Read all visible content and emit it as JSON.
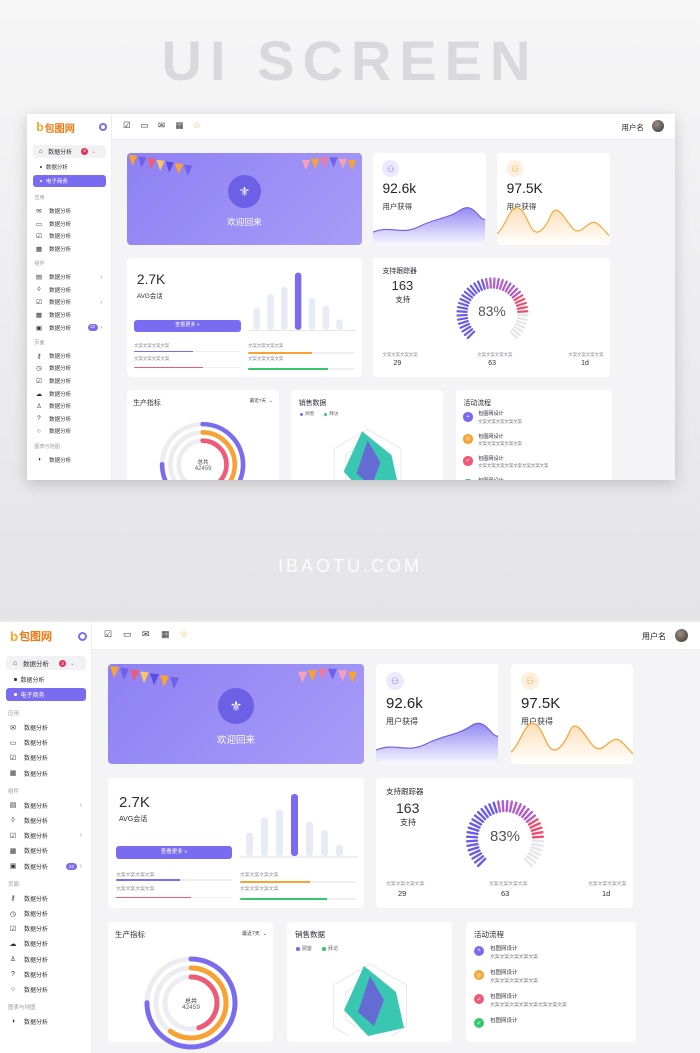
{
  "banner": {
    "title": "UI SCREEN",
    "watermark": "IBAOTU.COM"
  },
  "app": {
    "brand": "包图网",
    "username": "用户名",
    "sidebar": {
      "top_group": {
        "label": "数据分析",
        "badge": "3"
      },
      "sub_items": [
        "数据分析",
        "电子商务"
      ],
      "sections": [
        {
          "title": "应用",
          "items": [
            {
              "icon": "mail-icon",
              "label": "数据分析"
            },
            {
              "icon": "chat-icon",
              "label": "数据分析"
            },
            {
              "icon": "checkbox-icon",
              "label": "数据分析"
            },
            {
              "icon": "calendar-icon",
              "label": "数据分析"
            }
          ]
        },
        {
          "title": "组件",
          "items": [
            {
              "icon": "card-icon",
              "label": "数据分析",
              "arrow": true
            },
            {
              "icon": "drop-icon",
              "label": "数据分析"
            },
            {
              "icon": "checkbox-icon",
              "label": "数据分析",
              "arrow": true
            },
            {
              "icon": "calendar-icon",
              "label": "数据分析"
            },
            {
              "icon": "archive-icon",
              "label": "数据分析",
              "pill": "22",
              "arrow": true
            }
          ]
        },
        {
          "title": "页面",
          "items": [
            {
              "icon": "key-icon",
              "label": "数据分析"
            },
            {
              "icon": "clock-icon",
              "label": "数据分析"
            },
            {
              "icon": "checkbox-icon",
              "label": "数据分析"
            },
            {
              "icon": "cloud-icon",
              "label": "数据分析"
            },
            {
              "icon": "user-icon",
              "label": "数据分析"
            },
            {
              "icon": "help-icon",
              "label": "数据分析"
            },
            {
              "icon": "search-icon",
              "label": "数据分析"
            }
          ]
        },
        {
          "title": "图表与地图",
          "items": [
            {
              "icon": "chart-icon",
              "label": "数据分析"
            }
          ]
        }
      ]
    },
    "welcome": {
      "text": "欢迎回来"
    },
    "stat_users": {
      "value": "92.6k",
      "label": "用户获得"
    },
    "stat_users2": {
      "value": "97.5K",
      "label": "用户获得"
    },
    "avg": {
      "value": "2.7K",
      "label": "AVG会话",
      "button": "查看更多 »",
      "bars": [
        0.38,
        0.62,
        0.75,
        1.0,
        0.55,
        0.42,
        0.18
      ],
      "progress": [
        {
          "label": "文案文案文案文案",
          "pct": 0.55,
          "color": "#7a6cf0"
        },
        {
          "label": "文案文案文案文案",
          "pct": 0.6,
          "color": "#f7a233"
        },
        {
          "label": "文案文案文案文案",
          "pct": 0.65,
          "color": "#ef5a77"
        },
        {
          "label": "文案文案文案文案",
          "pct": 0.75,
          "color": "#37c86e"
        }
      ]
    },
    "tracker": {
      "title": "支持跟踪器",
      "count": "163",
      "count_label": "支持",
      "percent": "83%",
      "percent_value": 0.83,
      "stats": [
        {
          "label": "文案文案文案文案",
          "value": "29"
        },
        {
          "label": "文案文案文案文案",
          "value": "63"
        },
        {
          "label": "文案文案文案文案",
          "value": "1d"
        }
      ]
    },
    "production": {
      "title": "生产指标",
      "range": "最近7天",
      "total_label": "总共",
      "total_value": "42459",
      "rings": [
        0.75,
        0.6,
        0.45
      ]
    },
    "sales": {
      "title": "销售数据",
      "legend": [
        {
          "name": "顾客",
          "color": "#7a6cf0"
        },
        {
          "name": "拜访",
          "color": "#37c86e"
        }
      ]
    },
    "activity": {
      "title": "活动流程",
      "items": [
        {
          "title": "包图网设计",
          "desc": "文案文案文案文案文案",
          "color": "#7a6cf0",
          "icon": "plus-icon"
        },
        {
          "title": "包图网设计",
          "desc": "文案文案文案文案文案",
          "color": "#f7a233",
          "icon": "target-icon"
        },
        {
          "title": "包图网设计",
          "desc": "文案文案文案文案文案文案文案文案",
          "color": "#ef5a77",
          "icon": "check-icon"
        },
        {
          "title": "包图网设计",
          "desc": "",
          "color": "#37c86e",
          "icon": "check-icon"
        }
      ]
    }
  }
}
